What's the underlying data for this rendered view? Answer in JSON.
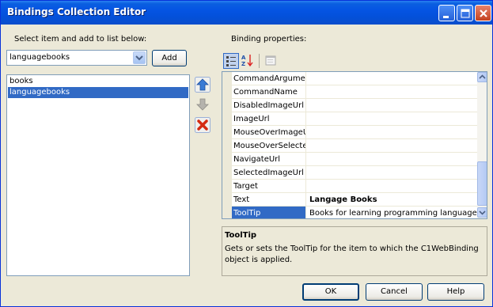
{
  "window": {
    "title": "Bindings Collection Editor",
    "controls": [
      "minimize-icon",
      "maximize-icon",
      "close-icon"
    ]
  },
  "left": {
    "select_label": "Select item and add to list below:",
    "combo_value": "languagebooks",
    "add_label": "Add",
    "items": [
      {
        "label": "books",
        "selected": false
      },
      {
        "label": "languagebooks",
        "selected": true
      }
    ],
    "buttons": [
      "move-up-icon",
      "move-down-icon",
      "delete-icon"
    ]
  },
  "right": {
    "properties_label": "Binding properties:",
    "toolbar": [
      "categorized-icon",
      "alphabetical-icon",
      "property-pages-icon"
    ],
    "rows": [
      {
        "name": "CommandArgument",
        "value": "",
        "selected": false,
        "bold": false
      },
      {
        "name": "CommandName",
        "value": "",
        "selected": false,
        "bold": false
      },
      {
        "name": "DisabledImageUrl",
        "value": "",
        "selected": false,
        "bold": false
      },
      {
        "name": "ImageUrl",
        "value": "",
        "selected": false,
        "bold": false
      },
      {
        "name": "MouseOverImageUrl",
        "value": "",
        "selected": false,
        "bold": false
      },
      {
        "name": "MouseOverSelected",
        "value": "",
        "selected": false,
        "bold": false
      },
      {
        "name": "NavigateUrl",
        "value": "",
        "selected": false,
        "bold": false
      },
      {
        "name": "SelectedImageUrl",
        "value": "",
        "selected": false,
        "bold": false
      },
      {
        "name": "Target",
        "value": "",
        "selected": false,
        "bold": false
      },
      {
        "name": "Text",
        "value": "Langage Books",
        "selected": false,
        "bold": true
      },
      {
        "name": "ToolTip",
        "value": "Books for learning programming languages",
        "selected": true,
        "bold": false
      }
    ],
    "description": {
      "title": "ToolTip",
      "text": "Gets or sets the ToolTip for the item to which the C1WebBinding object is applied."
    }
  },
  "footer": {
    "ok_label": "OK",
    "cancel_label": "Cancel",
    "help_label": "Help"
  },
  "colors": {
    "title_bar": "#0554e3",
    "selection": "#316ac5",
    "dialog_bg": "#ece9d8",
    "border": "#7f9db9"
  }
}
